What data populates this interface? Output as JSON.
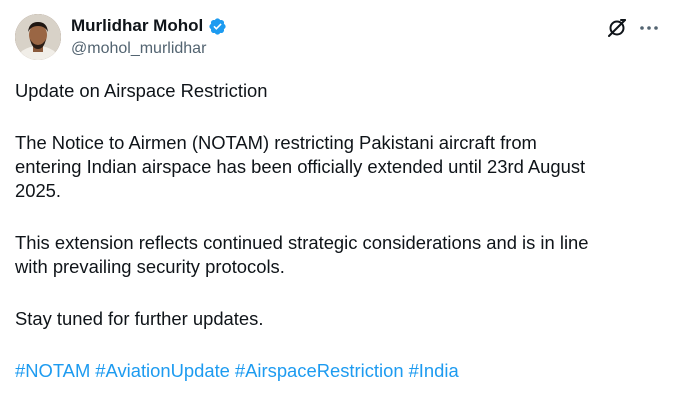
{
  "author": {
    "display_name": "Murlidhar Mohol",
    "handle": "@mohol_murlidhar",
    "verified": true,
    "verified_color": "#1d9bf0"
  },
  "icons": {
    "avatar": "profile-photo",
    "verified": "verified-badge-icon",
    "grok": "grok-icon",
    "more": "more-options-icon"
  },
  "post": {
    "title": "Update on Airspace Restriction",
    "paragraph_1_line_1": "The Notice to Airmen (NOTAM) restricting Pakistani aircraft from",
    "paragraph_1_line_2": "entering Indian airspace has been officially extended until 23rd August",
    "paragraph_1_line_3": "2025.",
    "paragraph_2_line_1": "This extension reflects continued strategic considerations and is in line",
    "paragraph_2_line_2": "with prevailing security protocols.",
    "paragraph_3": "Stay tuned for further updates.",
    "hashtags": [
      "#NOTAM",
      "#AviationUpdate",
      "#AirspaceRestriction",
      "#India"
    ]
  },
  "colors": {
    "text": "#0f1419",
    "secondary_text": "#536471",
    "link": "#1d9bf0"
  }
}
